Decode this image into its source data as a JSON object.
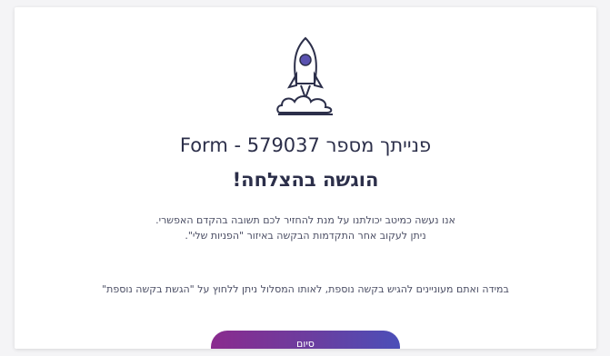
{
  "confirmation": {
    "title_line1": "פנייתך מספר 579037 - Form",
    "title_line2": "הוגשה בהצלחה!",
    "body_line1": "אנו נעשה כמיטב יכולתנו על מנת להחזיר לכם תשובה בהקדם האפשרי.",
    "body_line2": "ניתן לעקוב אחר התקדמות הבקשה באיזור \"הפניות שלי\".",
    "extra_info": "במידה ואתם מעוניינים להגיש בקשה נוספת, לאותו המסלול ניתן ללחוץ על \"הגשת בקשה נוספת\"",
    "finish_label": "סיום",
    "icon": "rocket-icon",
    "colors": {
      "text": "#2c2f4a",
      "button_start": "#8a2b8e",
      "button_end": "#4b4fb8"
    }
  }
}
